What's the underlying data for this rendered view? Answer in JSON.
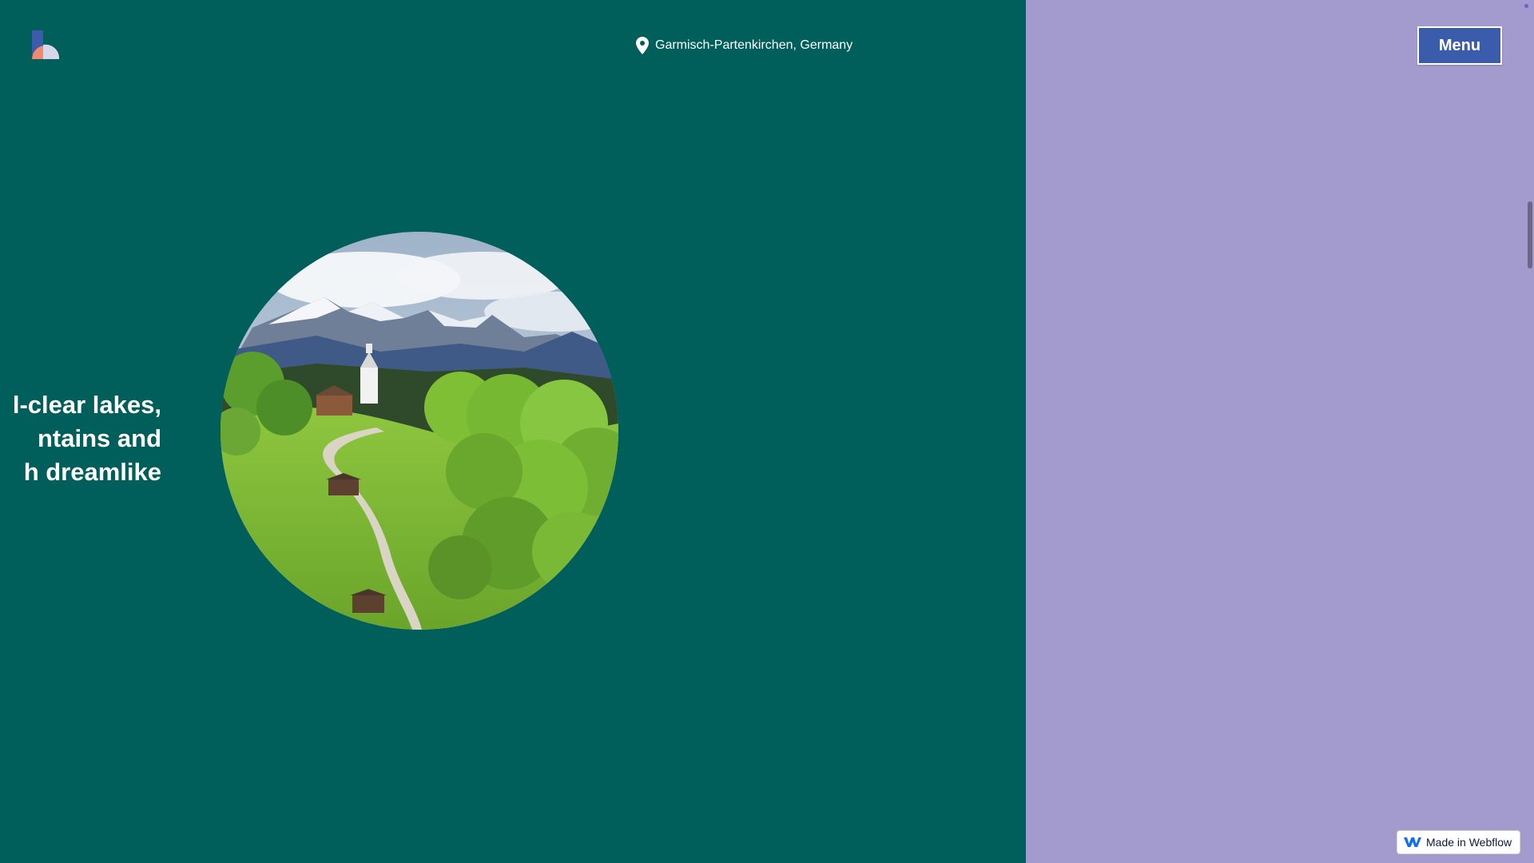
{
  "header": {
    "location": "Garmisch-Partenkirchen, Germany",
    "menu_label": "Menu"
  },
  "hero": {
    "lines": [
      "l-clear lakes,",
      "ntains and",
      "h dreamlike"
    ]
  },
  "badge": {
    "label": "Made in Webflow"
  },
  "icons": {
    "logo": "brand-logo",
    "location": "map-pin-icon",
    "webflow": "webflow-icon"
  },
  "colors": {
    "left_bg": "#005e5b",
    "right_bg": "#a39acd",
    "menu_bg": "#3a5caa"
  }
}
